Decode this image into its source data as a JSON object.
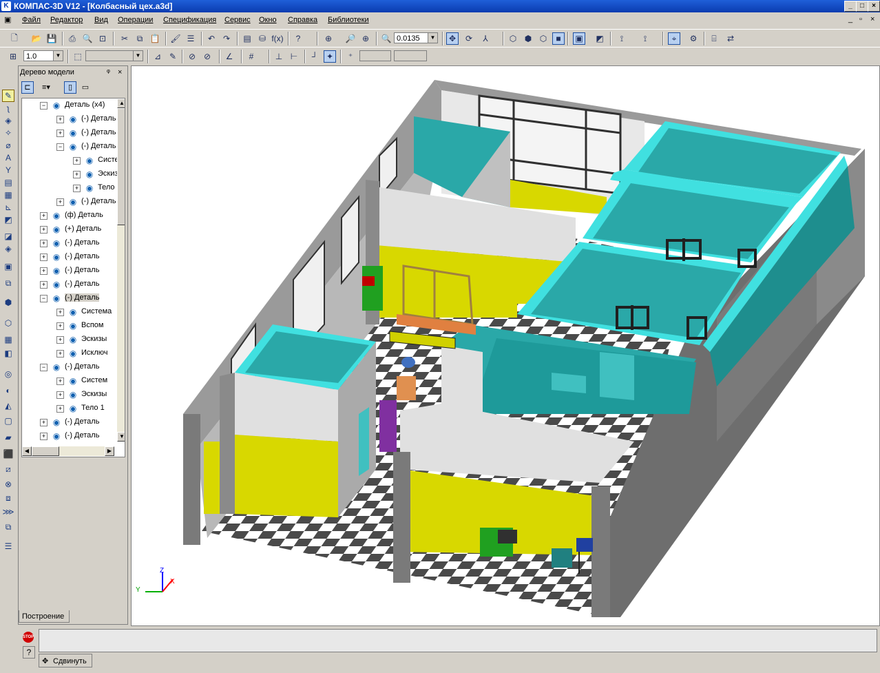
{
  "window": {
    "title": "КОМПАС-3D V12 - [Колбасный цех.a3d]",
    "min": "_",
    "max": "□",
    "close": "×"
  },
  "menu": [
    "Файл",
    "Редактор",
    "Вид",
    "Операции",
    "Спецификация",
    "Сервис",
    "Окно",
    "Справка",
    "Библиотеки"
  ],
  "toolbar": {
    "scale_value": "0.0135",
    "line_width_value": "1.0"
  },
  "panel": {
    "title": "Дерево модели",
    "pin": "ᵠ",
    "close": "×",
    "bottom_tab": "Построение",
    "tree": [
      {
        "indent": 0,
        "pm": "−",
        "label": "Деталь (x4)"
      },
      {
        "indent": 1,
        "pm": "+",
        "label": "(-) Деталь"
      },
      {
        "indent": 1,
        "pm": "+",
        "label": "(-) Деталь"
      },
      {
        "indent": 1,
        "pm": "−",
        "label": "(-) Деталь"
      },
      {
        "indent": 2,
        "pm": "+",
        "label": "Система"
      },
      {
        "indent": 2,
        "pm": "+",
        "label": "Эскизы"
      },
      {
        "indent": 2,
        "pm": "+",
        "label": "Тело"
      },
      {
        "indent": 1,
        "pm": "+",
        "label": "(-) Деталь"
      },
      {
        "indent": 0,
        "pm": "+",
        "label": "(ф) Деталь"
      },
      {
        "indent": 0,
        "pm": "+",
        "label": "(+) Деталь"
      },
      {
        "indent": 0,
        "pm": "+",
        "label": "(-) Деталь"
      },
      {
        "indent": 0,
        "pm": "+",
        "label": "(-) Деталь"
      },
      {
        "indent": 0,
        "pm": "+",
        "label": "(-) Деталь"
      },
      {
        "indent": 0,
        "pm": "+",
        "label": "(-) Деталь"
      },
      {
        "indent": 0,
        "pm": "−",
        "label": "(-) Деталь",
        "selected": true
      },
      {
        "indent": 1,
        "pm": "+",
        "label": "Система"
      },
      {
        "indent": 1,
        "pm": "+",
        "label": "Вспом"
      },
      {
        "indent": 1,
        "pm": "+",
        "label": "Эскизы"
      },
      {
        "indent": 1,
        "pm": "+",
        "label": "Исключ"
      },
      {
        "indent": 0,
        "pm": "−",
        "label": "(-) Деталь"
      },
      {
        "indent": 1,
        "pm": "+",
        "label": "Систем"
      },
      {
        "indent": 1,
        "pm": "+",
        "label": "Эскизы"
      },
      {
        "indent": 1,
        "pm": "+",
        "label": "Тело 1"
      },
      {
        "indent": 0,
        "pm": "+",
        "label": "(-) Деталь"
      },
      {
        "indent": 0,
        "pm": "+",
        "label": "(-) Деталь"
      }
    ]
  },
  "axes": {
    "x": "X",
    "y": "Y",
    "z": "Z"
  },
  "status": {
    "stop_label": "STOP",
    "help": "?",
    "command": "Сдвинуть"
  },
  "colors": {
    "wall_gray": "#8a8a8a",
    "wall_dark": "#5a5a5a",
    "teal": "#2aa8a8",
    "teal_top": "#40e0e0",
    "yellow": "#d8d800",
    "floor_black": "#505050",
    "floor_white": "#ffffff"
  }
}
